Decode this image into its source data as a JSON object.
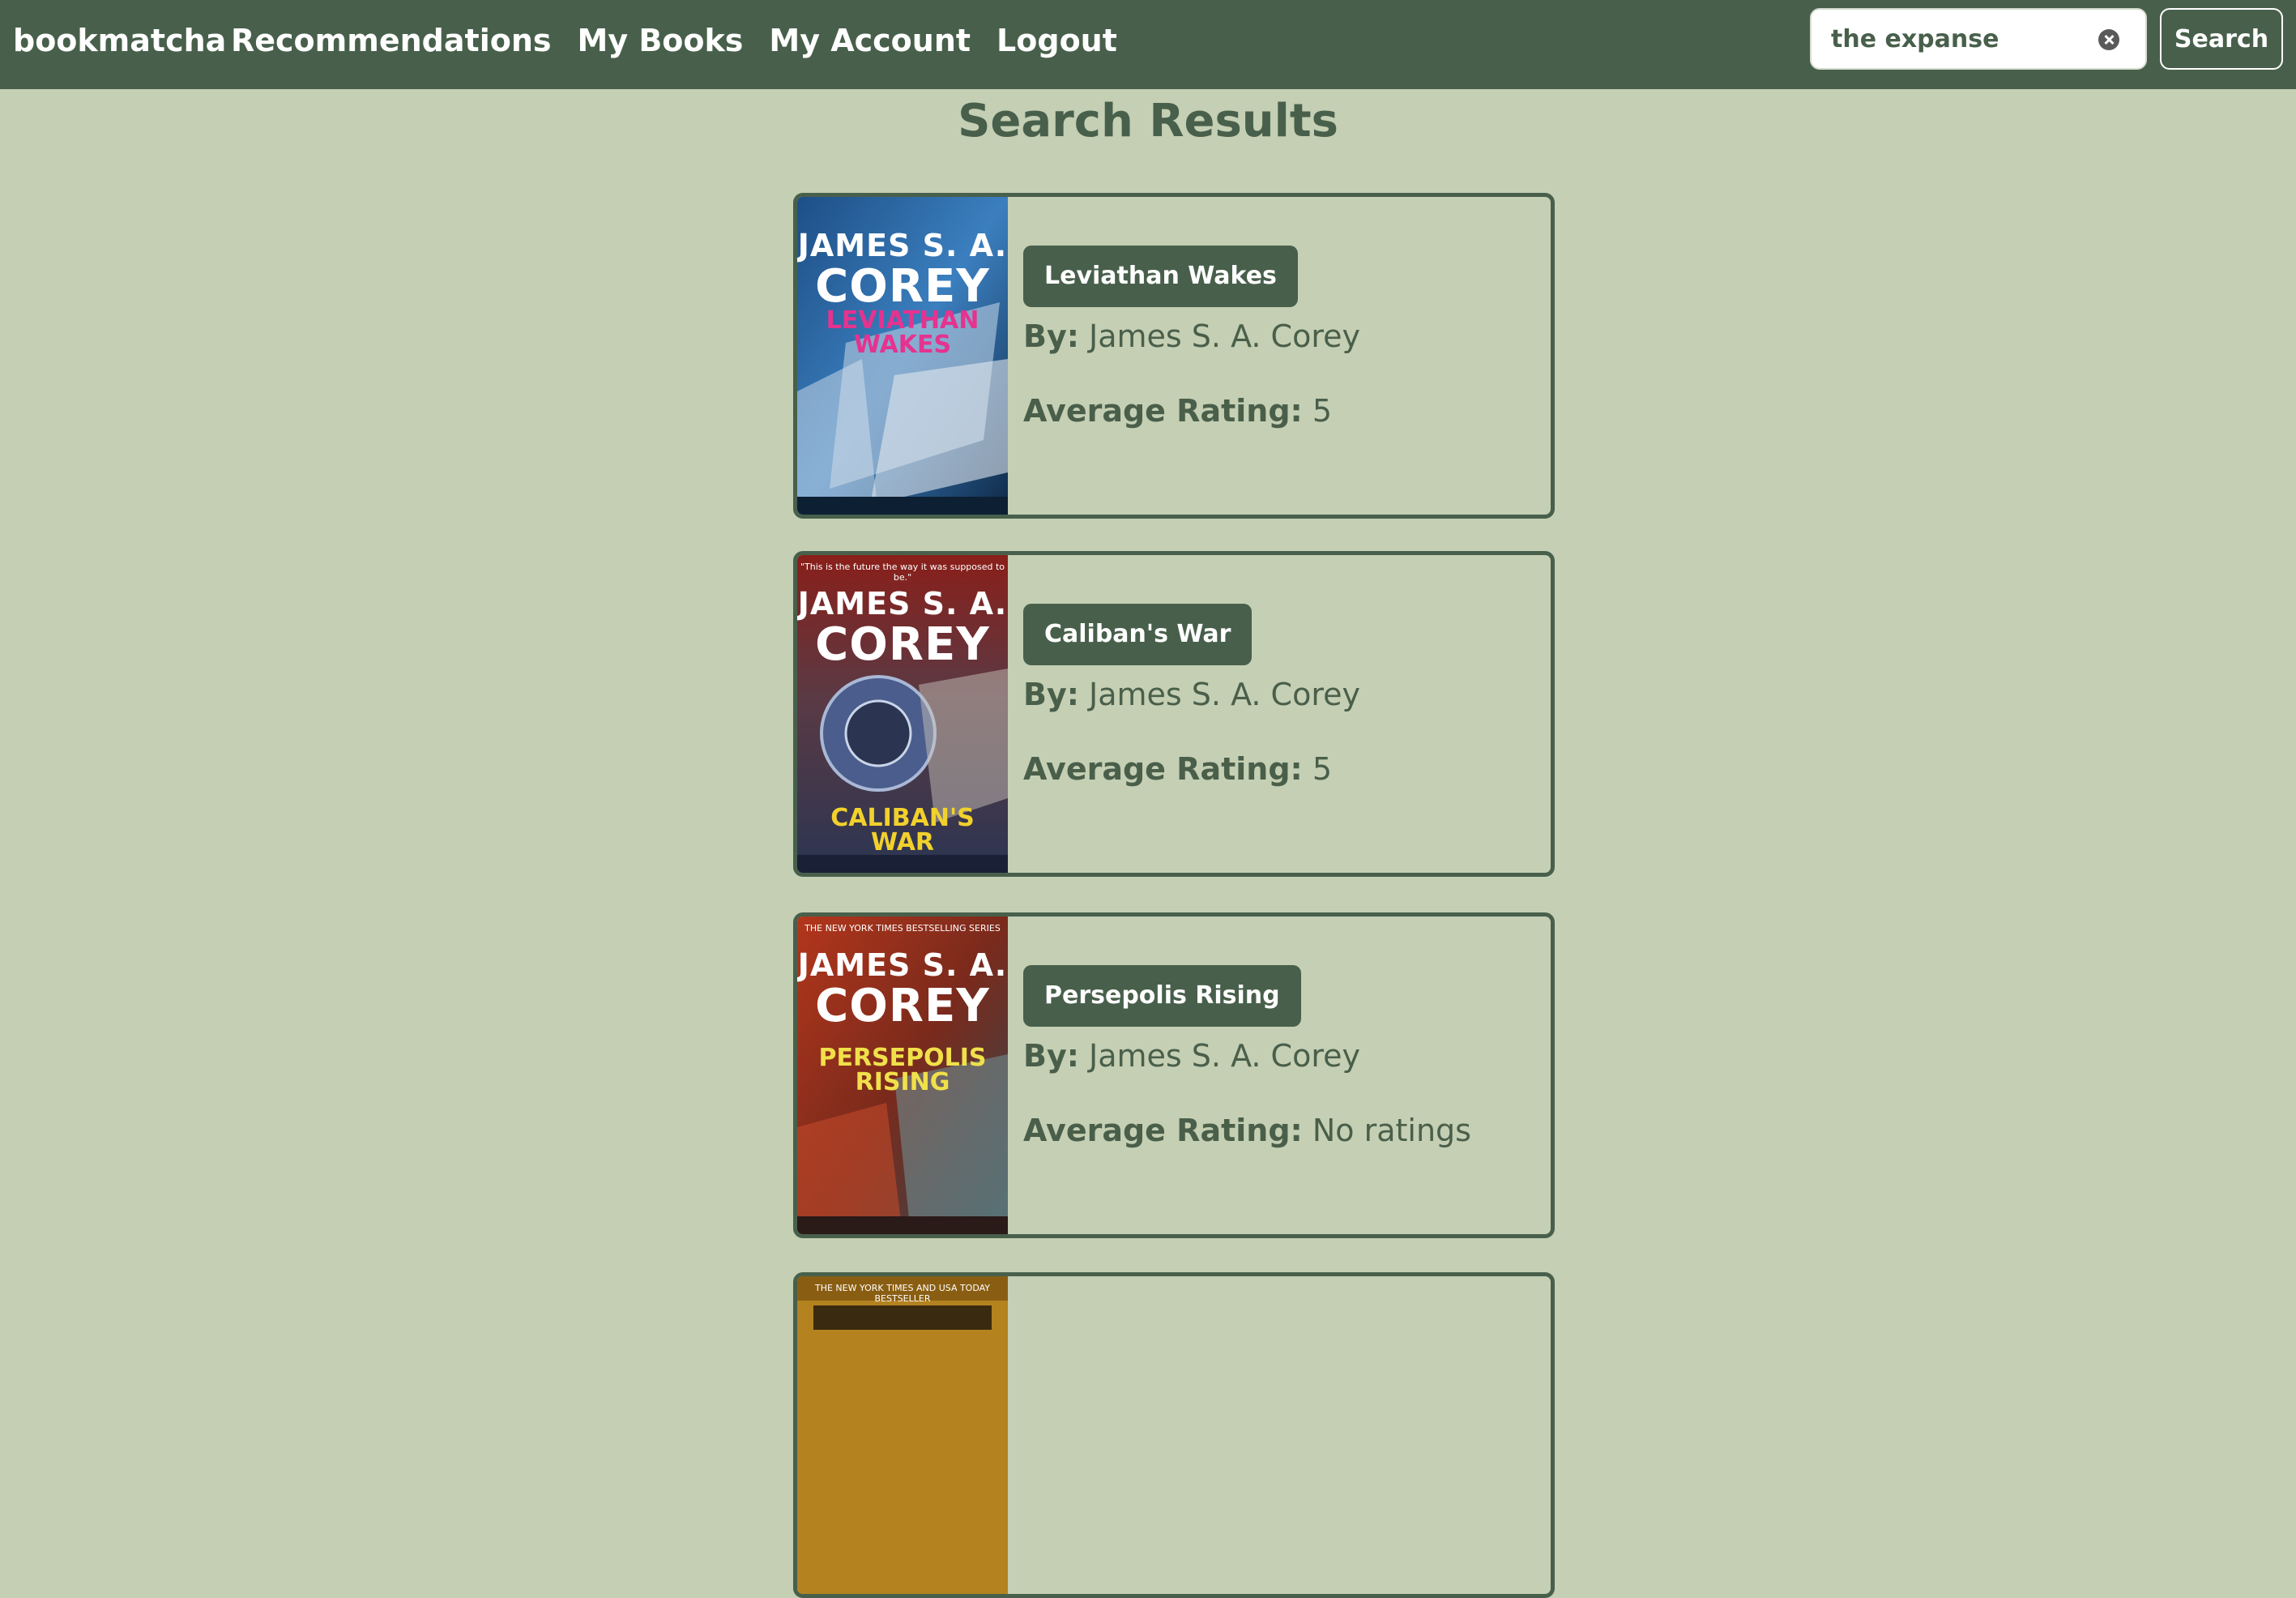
{
  "nav": {
    "brand": "bookmatcha",
    "links": [
      "Recommendations",
      "My Books",
      "My Account",
      "Logout"
    ]
  },
  "search": {
    "value": "the expanse",
    "button_label": "Search"
  },
  "page_title": "Search Results",
  "labels": {
    "by": "By:",
    "rating": "Average Rating:"
  },
  "results": [
    {
      "title": "Leviathan Wakes",
      "author": "James S. A. Corey",
      "rating": "5",
      "cover": {
        "author_line1": "JAMES S. A.",
        "author_line2": "COREY",
        "title": "LEVIATHAN WAKES"
      }
    },
    {
      "title": "Caliban's War",
      "author": "James S. A. Corey",
      "rating": "5",
      "cover": {
        "tagline": "\"This is the future the way it was supposed to be.\"",
        "author_line1": "JAMES S. A.",
        "author_line2": "COREY",
        "title": "CALIBAN'S WAR"
      }
    },
    {
      "title": "Persepolis Rising",
      "author": "James S. A. Corey",
      "rating": "No ratings",
      "cover": {
        "tagline": "THE NEW YORK TIMES BESTSELLING SERIES",
        "author_line1": "JAMES S. A.",
        "author_line2": "COREY",
        "title": "PERSEPOLIS RISING"
      }
    },
    {
      "title": "",
      "author": "",
      "rating": "",
      "cover": {
        "tagline": "THE NEW YORK TIMES AND USA TODAY BESTSELLER"
      }
    }
  ],
  "colors": {
    "background": "#c4cfb4",
    "nav": "#48604b",
    "accent": "#48604b"
  },
  "icons": {
    "clear": "clear-search-icon"
  }
}
